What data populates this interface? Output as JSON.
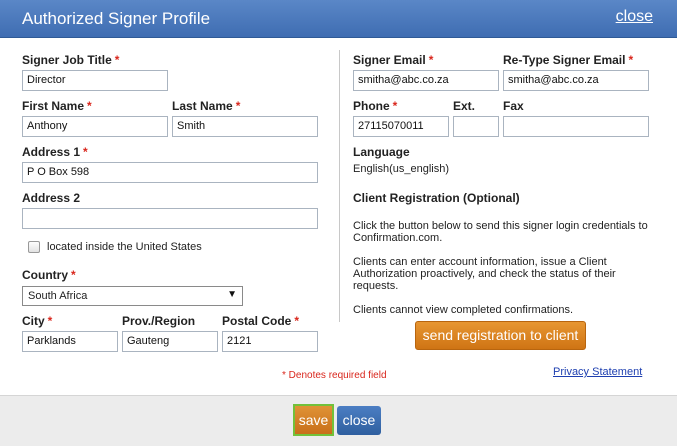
{
  "dialog": {
    "title": "Authorized Signer Profile",
    "close_link": "close"
  },
  "required_marker": "*",
  "left": {
    "job_title": {
      "label": "Signer Job Title",
      "value": "Director"
    },
    "first_name": {
      "label": "First Name",
      "value": "Anthony"
    },
    "last_name": {
      "label": "Last Name",
      "value": "Smith"
    },
    "address1": {
      "label": "Address 1",
      "value": "P O Box 598"
    },
    "address2": {
      "label": "Address 2",
      "value": ""
    },
    "us_checkbox": {
      "label": "located inside the United States",
      "checked": false
    },
    "country": {
      "label": "Country",
      "value": "South Africa"
    },
    "city": {
      "label": "City",
      "value": "Parklands"
    },
    "province": {
      "label": "Prov./Region",
      "value": "Gauteng"
    },
    "postal": {
      "label": "Postal Code",
      "value": "2121"
    }
  },
  "right": {
    "email": {
      "label": "Signer Email",
      "value": "smitha@abc.co.za"
    },
    "retype_email": {
      "label": "Re-Type Signer Email",
      "value": "smitha@abc.co.za"
    },
    "phone": {
      "label": "Phone",
      "value": "27115070011"
    },
    "ext": {
      "label": "Ext.",
      "value": ""
    },
    "fax": {
      "label": "Fax",
      "value": ""
    },
    "language": {
      "label": "Language",
      "value": "English(us_english)"
    },
    "registration": {
      "heading": "Client Registration (Optional)",
      "para1": "Click the button below to send this signer login credentials to Confirmation.com.",
      "para2": "Clients can enter account information, issue a Client Authorization proactively, and check the status of their requests.",
      "para3": "Clients cannot view completed confirmations.",
      "button": "send registration to client"
    }
  },
  "required_note": "* Denotes required field",
  "privacy_link": "Privacy Statement",
  "footer": {
    "save": "save",
    "close": "close"
  },
  "colors": {
    "header": "#4a78bb",
    "accent_orange": "#d97d1f",
    "required_red": "#d9261c",
    "link_blue": "#1e3fb0"
  }
}
